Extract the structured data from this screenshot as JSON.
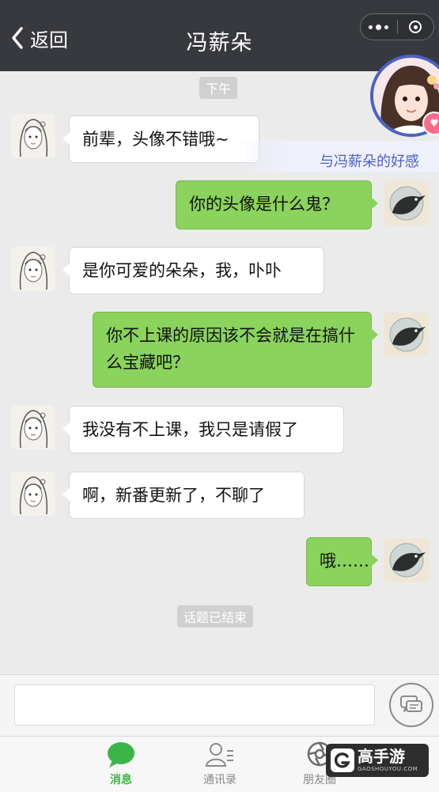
{
  "header": {
    "back_label": "返回",
    "title": "冯薪朵"
  },
  "affinity": {
    "label": "与冯薪朵的好感"
  },
  "chat": {
    "time_label": "下午",
    "end_label": "话题已结束",
    "messages": [
      {
        "from": "她",
        "text": "前辈，头像不错哦~"
      },
      {
        "from": "我",
        "text": "你的头像是什么鬼？"
      },
      {
        "from": "她",
        "text": "是你可爱的朵朵，我，卟卟"
      },
      {
        "from": "我",
        "text": "你不上课的原因该不会就是在搞什么宝藏吧？"
      },
      {
        "from": "她",
        "text": "我没有不上课，我只是请假了"
      },
      {
        "from": "她",
        "text": "啊，新番更新了，不聊了"
      },
      {
        "from": "我",
        "text": "哦……"
      }
    ]
  },
  "input": {
    "value": "",
    "placeholder": ""
  },
  "tabs": [
    {
      "label": "消息",
      "icon": "chat-bubble-icon",
      "active": true
    },
    {
      "label": "通讯录",
      "icon": "contacts-icon",
      "active": false
    },
    {
      "label": "朋友圈",
      "icon": "moments-icon",
      "active": false
    }
  ],
  "watermark": {
    "main": "高手游",
    "sub": "GAOSHOUYOU.COM"
  },
  "colors": {
    "header_bg": "#37393e",
    "outgoing_bubble": "#8ad35c",
    "active_tab": "#3bb549",
    "affinity_accent": "#4a63c9"
  }
}
